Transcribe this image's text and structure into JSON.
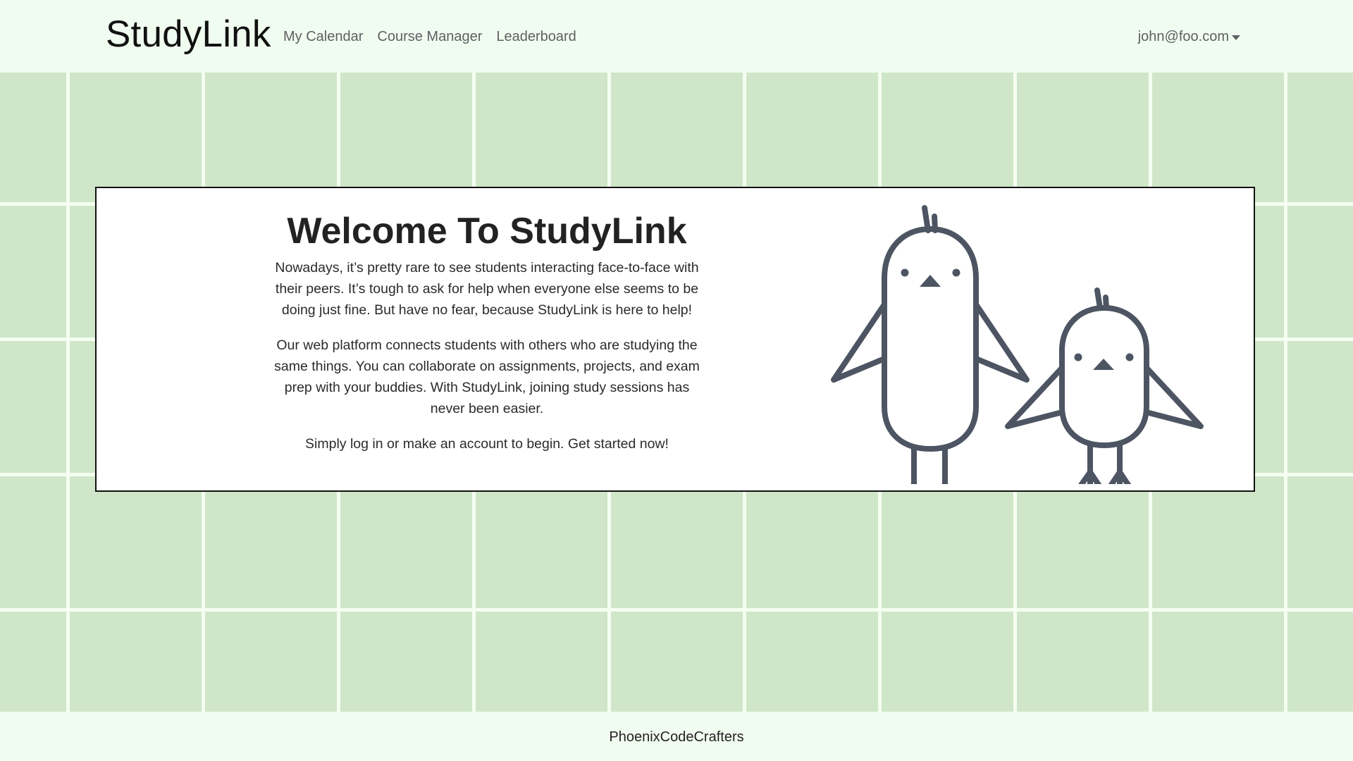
{
  "navbar": {
    "brand": "StudyLink",
    "links": [
      {
        "label": "My Calendar"
      },
      {
        "label": "Course Manager"
      },
      {
        "label": "Leaderboard"
      }
    ],
    "user": "john@foo.com"
  },
  "welcome": {
    "title": "Welcome To StudyLink",
    "paragraphs": [
      "Nowadays, it’s pretty rare to see students interacting face-to-face with their peers. It’s tough to ask for help when everyone else seems to be doing just fine. But have no fear, because StudyLink is here to help!",
      "Our web platform connects students with others who are studying the same things. You can collaborate on assignments, projects, and exam prep with your buddies. With StudyLink, joining study sessions has never been easier.",
      "Simply log in or make an account to begin. Get started now!"
    ]
  },
  "footer": {
    "text": "PhoenixCodeCrafters"
  },
  "colors": {
    "page_bg": "#f1fcf0",
    "grid_bg": "#cfe6c9",
    "bird_stroke": "#4d5563"
  },
  "icons": {
    "illustration": "two-chicks-illustration",
    "caret": "caret-down-icon"
  }
}
